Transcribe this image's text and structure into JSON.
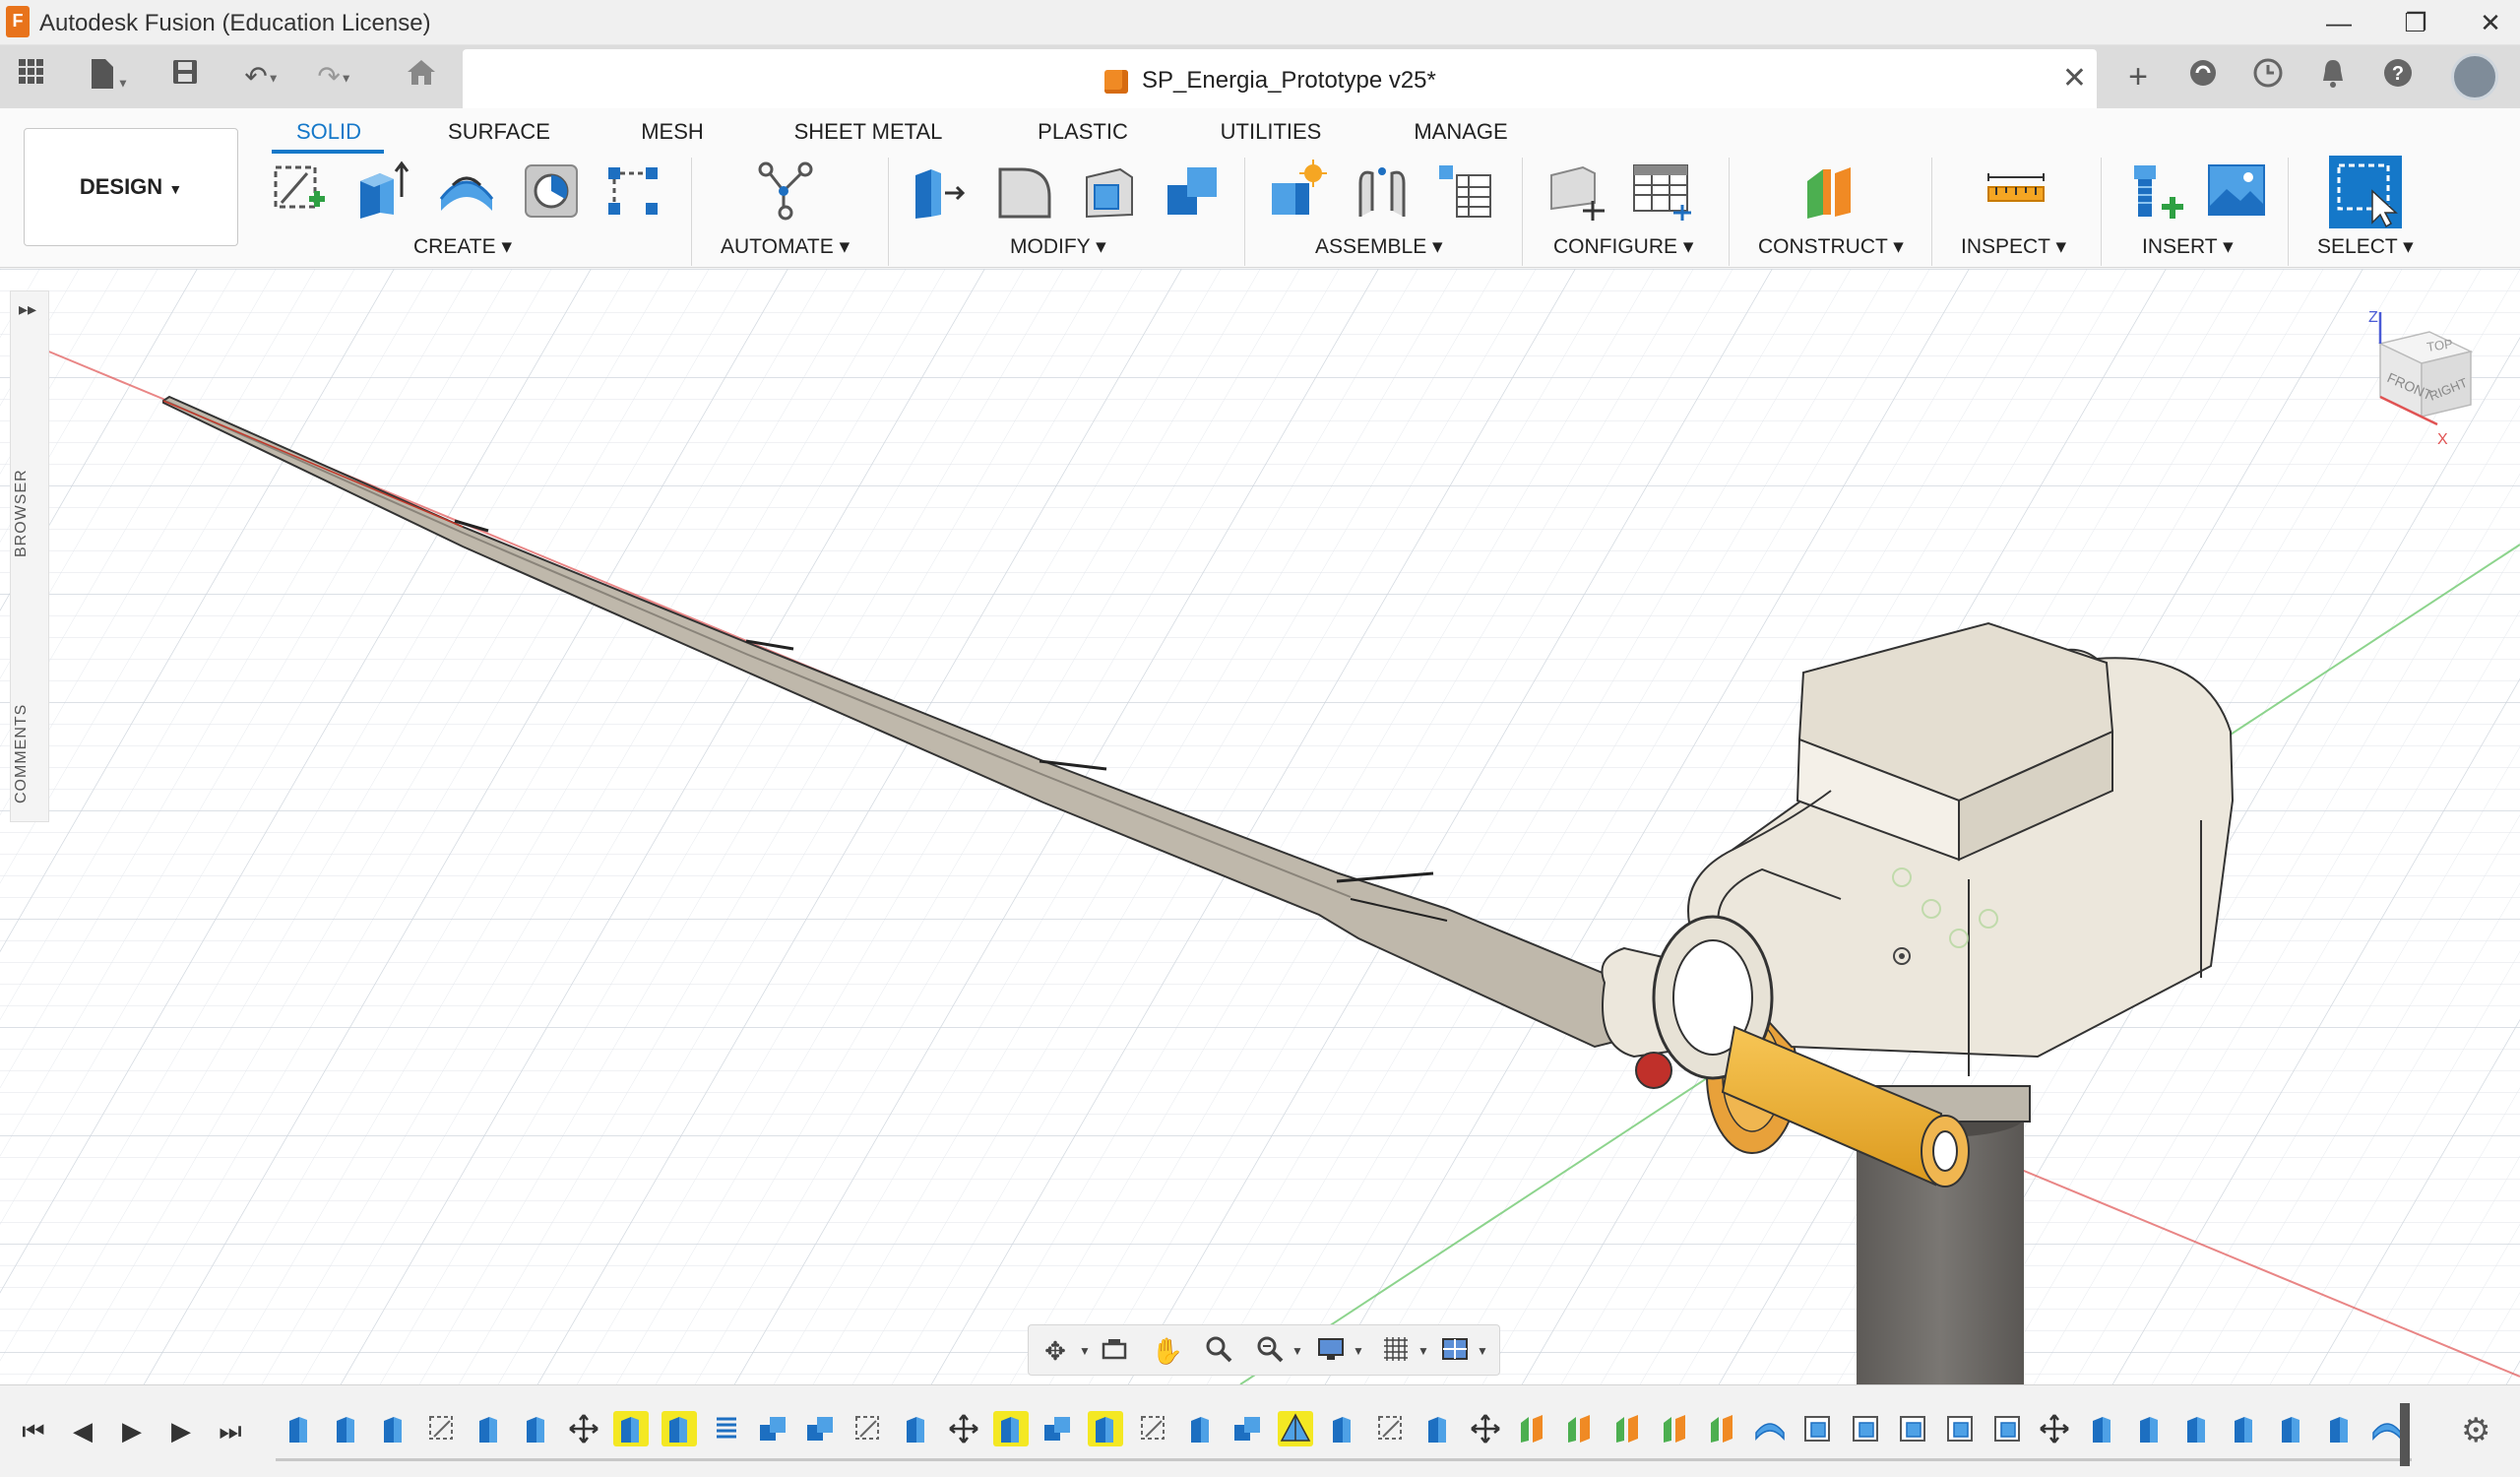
{
  "window": {
    "title": "Autodesk Fusion (Education License)",
    "logo_letter": "F",
    "controls": [
      "minimize-icon",
      "restore-icon",
      "close-icon"
    ]
  },
  "quick_access": {
    "icons": [
      "grid-menu-icon",
      "file-icon",
      "save-icon",
      "undo-icon",
      "redo-icon",
      "home-icon"
    ]
  },
  "document": {
    "title": "SP_Energia_Prototype v25*",
    "close_glyph": "✕"
  },
  "right_icons": [
    "new-tab-icon",
    "extensions-icon",
    "job-status-icon",
    "notifications-icon",
    "help-icon",
    "user-avatar"
  ],
  "workspace": {
    "label": "DESIGN"
  },
  "tabs": [
    {
      "label": "SOLID",
      "active": true
    },
    {
      "label": "SURFACE",
      "active": false
    },
    {
      "label": "MESH",
      "active": false
    },
    {
      "label": "SHEET METAL",
      "active": false
    },
    {
      "label": "PLASTIC",
      "active": false
    },
    {
      "label": "UTILITIES",
      "active": false
    },
    {
      "label": "MANAGE",
      "active": false
    }
  ],
  "groups": {
    "create": "CREATE",
    "automate": "AUTOMATE",
    "modify": "MODIFY",
    "assemble": "ASSEMBLE",
    "configure": "CONFIGURE",
    "construct": "CONSTRUCT",
    "inspect": "INSPECT",
    "insert": "INSERT",
    "select": "SELECT"
  },
  "tools": {
    "create": [
      "create-sketch-icon",
      "extrude-icon",
      "revolve-icon",
      "hole-icon",
      "pattern-icon"
    ],
    "automate": [
      "automate-icon"
    ],
    "modify": [
      "press-pull-icon",
      "fillet-icon",
      "shell-icon",
      "combine-icon"
    ],
    "assemble": [
      "new-component-icon",
      "joint-icon",
      "bom-icon"
    ],
    "configure": [
      "configure-icon",
      "table-icon"
    ],
    "construct": [
      "plane-icon"
    ],
    "inspect": [
      "measure-icon"
    ],
    "insert": [
      "insert-mesh-icon",
      "insert-image-icon"
    ],
    "select": [
      "select-icon"
    ]
  },
  "side_panel": {
    "expand_glyph": "▸▸",
    "browser_label": "BROWSER",
    "comments_label": "COMMENTS"
  },
  "viewcube": {
    "top": "TOP",
    "front": "FRONT",
    "right": "RIGHT",
    "axis_z": "Z",
    "axis_x": "X"
  },
  "navbar_icons": [
    "orbit-icon",
    "look-at-icon",
    "pan-icon",
    "zoom-icon",
    "fit-icon",
    "display-settings-icon",
    "grid-settings-icon",
    "viewports-icon"
  ],
  "timeline": {
    "controls": [
      "first-icon",
      "previous-icon",
      "play-icon",
      "next-icon",
      "last-icon"
    ],
    "feature_count": 45,
    "settings_icon": "gear-icon"
  },
  "colors": {
    "accent": "#1578c9",
    "shaft": "#f2b43a",
    "model": "#ece7dc",
    "tower": "#6d6a66",
    "grid": "#d6dce4",
    "axis_red": "#e05353",
    "axis_green": "#5ec35e",
    "timeline_highlight": "#f4e823"
  }
}
